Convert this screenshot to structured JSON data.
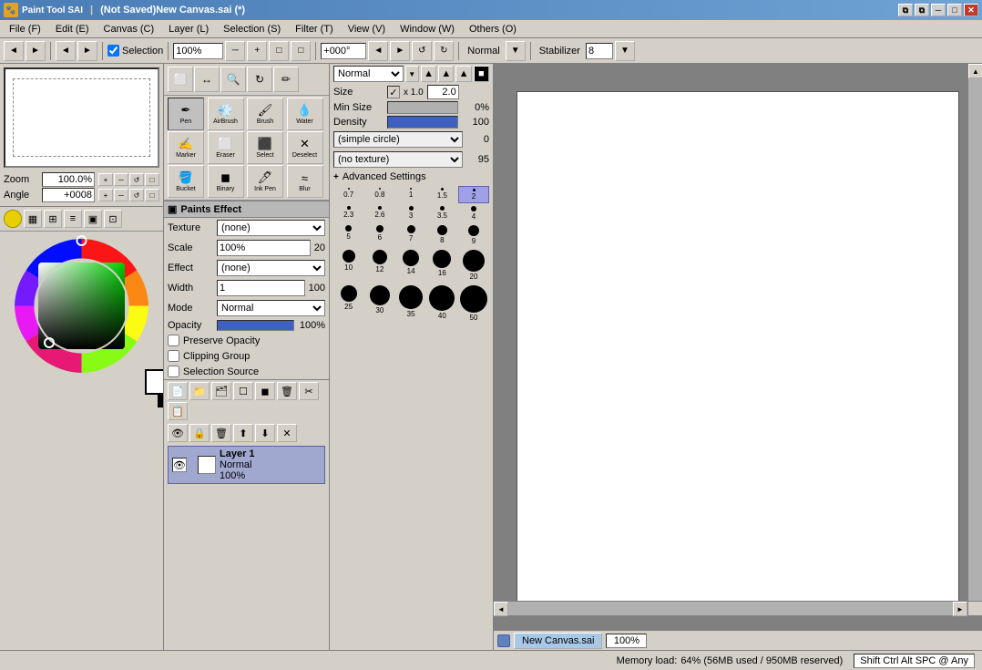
{
  "titleBar": {
    "icon": "🎨",
    "title": "(Not Saved)New Canvas.sai (*)",
    "appName": "Paint Tool SAI",
    "buttons": {
      "minimize": "─",
      "maximize": "□",
      "close": "✕",
      "restore1": "⧉",
      "restore2": "⧉"
    }
  },
  "menuBar": {
    "items": [
      {
        "label": "File (F)"
      },
      {
        "label": "Edit (E)"
      },
      {
        "label": "Canvas (C)"
      },
      {
        "label": "Layer (L)"
      },
      {
        "label": "Selection (S)"
      },
      {
        "label": "Filter (T)"
      },
      {
        "label": "View (V)"
      },
      {
        "label": "Window (W)"
      },
      {
        "label": "Others (O)"
      }
    ]
  },
  "toolbar": {
    "navBtns": [
      "◄",
      "►",
      "◄",
      "►"
    ],
    "selectionCheckbox": true,
    "selectionLabel": "Selection",
    "zoomValue": "100%",
    "zoomBtns": [
      "─",
      "+",
      "□",
      "□"
    ],
    "rotationValue": "+000°",
    "rotationBtns": [
      "◄",
      "►",
      "↺",
      "↻"
    ],
    "normalLabel": "Normal",
    "stabilizerLabel": "Stabilizer",
    "stabilizerValue": "8"
  },
  "leftPanel": {
    "zoom": {
      "label": "Zoom",
      "value": "100.0%"
    },
    "angle": {
      "label": "Angle",
      "value": "+0008"
    }
  },
  "colorWheel": {
    "icons": [
      "⬤",
      "▦",
      "⊞",
      "⊟",
      "▣",
      "⊡"
    ]
  },
  "paintsEffect": {
    "title": "Paints Effect",
    "texture": {
      "label": "Texture",
      "value": "(none)"
    },
    "scale": {
      "label": "Scale",
      "value": "100%",
      "max": "20"
    },
    "effect": {
      "label": "Effect",
      "value": "(none)"
    },
    "width": {
      "label": "Width",
      "value": "1",
      "max": "100"
    },
    "mode": {
      "label": "Mode",
      "value": "Normal"
    },
    "opacity": {
      "label": "Opacity",
      "value": "100%"
    },
    "checkboxes": {
      "preserveOpacity": "Preserve Opacity",
      "clippingGroup": "Clipping Group",
      "selectionSource": "Selection Source"
    }
  },
  "layerPanel": {
    "toolBtns": [
      "📄",
      "📁",
      "🗂️",
      "☐",
      "🗑",
      "✂",
      "📋",
      "⬜"
    ],
    "toolBtns2": [
      "👁",
      "🔒",
      "🗑",
      "⬆",
      "⬇",
      "✕"
    ],
    "layer": {
      "name": "Layer 1",
      "mode": "Normal",
      "opacity": "100%"
    }
  },
  "toolIcons": {
    "selectionTools": [
      {
        "icon": "⊡",
        "label": ""
      },
      {
        "icon": "🔄",
        "label": ""
      },
      {
        "icon": "🔍",
        "label": ""
      },
      {
        "icon": "∿",
        "label": ""
      },
      {
        "icon": "✏",
        "label": ""
      }
    ]
  },
  "brushTools": {
    "items": [
      {
        "icon": "✒",
        "label": "Pen",
        "active": true
      },
      {
        "icon": "💨",
        "label": "AirBrush"
      },
      {
        "icon": "🖌",
        "label": "Brush"
      },
      {
        "icon": "💧",
        "label": "Water"
      },
      {
        "icon": "✍",
        "label": "Marker"
      },
      {
        "icon": "⬜",
        "label": "Eraser"
      },
      {
        "icon": "⬛",
        "label": "Select"
      },
      {
        "icon": "✕",
        "label": "Deselect"
      },
      {
        "icon": "🪣",
        "label": "Bucket"
      },
      {
        "icon": "🔲",
        "label": "Binary"
      },
      {
        "icon": "🖊",
        "label": "Ink Pen"
      },
      {
        "icon": "≈",
        "label": "Blur"
      }
    ]
  },
  "blendMode": {
    "value": "Normal",
    "shapes": [
      "▲",
      "▲",
      "▲",
      "■"
    ]
  },
  "brushSettings": {
    "size": {
      "label": "Size",
      "multiplier": "x 1.0",
      "value": "2.0"
    },
    "minSize": {
      "label": "Min Size",
      "value": "0%"
    },
    "density": {
      "label": "Density",
      "value": "100"
    },
    "shapeSelect": "(simple circle)",
    "shapeValue": "0",
    "textureSelect": "(no texture)",
    "textureValue": "95",
    "advancedSettings": "Advanced Settings"
  },
  "brushSizes": [
    {
      "size": 0.7,
      "dotSize": 2,
      "label": "0.7"
    },
    {
      "size": 0.8,
      "dotSize": 2,
      "label": "0.8"
    },
    {
      "size": 1,
      "dotSize": 2,
      "label": "1"
    },
    {
      "size": 1.5,
      "dotSize": 3,
      "label": "1.5"
    },
    {
      "size": 2,
      "dotSize": 3,
      "label": "2",
      "active": true
    },
    {
      "size": 2.3,
      "dotSize": 4,
      "label": "2.3"
    },
    {
      "size": 2.6,
      "dotSize": 4,
      "label": "2.6"
    },
    {
      "size": 3,
      "dotSize": 5,
      "label": "3"
    },
    {
      "size": 3.5,
      "dotSize": 5,
      "label": "3.5"
    },
    {
      "size": 4,
      "dotSize": 6,
      "label": "4"
    },
    {
      "size": 5,
      "dotSize": 7,
      "label": "5"
    },
    {
      "size": 6,
      "dotSize": 8,
      "label": "6"
    },
    {
      "size": 7,
      "dotSize": 9,
      "label": "7"
    },
    {
      "size": 8,
      "dotSize": 11,
      "label": "8"
    },
    {
      "size": 9,
      "dotSize": 12,
      "label": "9"
    },
    {
      "size": 10,
      "dotSize": 14,
      "label": "10"
    },
    {
      "size": 12,
      "dotSize": 16,
      "label": "12"
    },
    {
      "size": 14,
      "dotSize": 18,
      "label": "14"
    },
    {
      "size": 16,
      "dotSize": 20,
      "label": "16"
    },
    {
      "size": 20,
      "dotSize": 24,
      "label": "20"
    },
    {
      "size": 25,
      "dotSize": 18,
      "label": "25"
    },
    {
      "size": 30,
      "dotSize": 22,
      "label": "30"
    },
    {
      "size": 35,
      "dotSize": 26,
      "label": "35"
    },
    {
      "size": 40,
      "dotSize": 28,
      "label": "40"
    },
    {
      "size": 50,
      "dotSize": 30,
      "label": "50"
    }
  ],
  "docTab": {
    "canvasName": "New Canvas.sai",
    "zoom": "100%"
  },
  "statusBar": {
    "memoryLabel": "Memory load:",
    "memoryValue": "64% (56MB used / 950MB reserved)",
    "keys": "Shift Ctrl Alt SPC @ Any"
  },
  "canvas": {
    "backgroundColor": "#ffffff"
  }
}
